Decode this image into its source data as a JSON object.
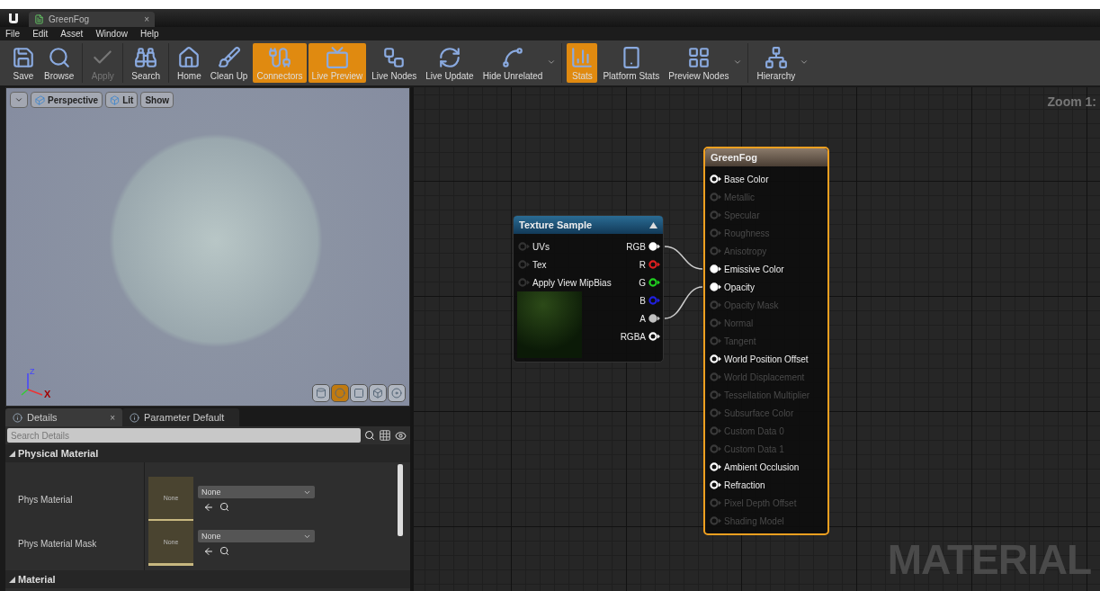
{
  "title_bar": {
    "tab": {
      "label": "GreenFog",
      "close": "×"
    }
  },
  "menu": [
    "File",
    "Edit",
    "Asset",
    "Window",
    "Help"
  ],
  "toolbar": [
    {
      "buttons": [
        {
          "label": "Save",
          "active": false,
          "disabled": false,
          "dropdown": false
        },
        {
          "label": "Browse",
          "active": false,
          "disabled": false,
          "dropdown": false
        }
      ]
    },
    {
      "buttons": [
        {
          "label": "Apply",
          "active": false,
          "disabled": true,
          "dropdown": false
        }
      ]
    },
    {
      "buttons": [
        {
          "label": "Search",
          "active": false,
          "disabled": false,
          "dropdown": false
        }
      ]
    },
    {
      "buttons": [
        {
          "label": "Home",
          "active": false,
          "disabled": false,
          "dropdown": false
        },
        {
          "label": "Clean Up",
          "active": false,
          "disabled": false,
          "dropdown": false
        },
        {
          "label": "Connectors",
          "active": true,
          "disabled": false,
          "dropdown": false
        },
        {
          "label": "Live Preview",
          "active": true,
          "disabled": false,
          "dropdown": false
        },
        {
          "label": "Live Nodes",
          "active": false,
          "disabled": false,
          "dropdown": false
        },
        {
          "label": "Live Update",
          "active": false,
          "disabled": false,
          "dropdown": false
        },
        {
          "label": "Hide Unrelated",
          "active": false,
          "disabled": false,
          "dropdown": true
        }
      ]
    },
    {
      "buttons": [
        {
          "label": "Stats",
          "active": true,
          "disabled": false,
          "dropdown": false
        },
        {
          "label": "Platform Stats",
          "active": false,
          "disabled": false,
          "dropdown": false
        },
        {
          "label": "Preview Nodes",
          "active": false,
          "disabled": false,
          "dropdown": true
        }
      ]
    },
    {
      "buttons": [
        {
          "label": "Hierarchy",
          "active": false,
          "disabled": false,
          "dropdown": true
        }
      ]
    }
  ],
  "viewport": {
    "buttons": [
      {
        "kind": "menu"
      },
      {
        "kind": "label",
        "label": "Perspective"
      },
      {
        "kind": "label",
        "label": "Lit"
      },
      {
        "kind": "label",
        "label": "Show"
      }
    ],
    "preview_shapes": [
      {
        "selected": false
      },
      {
        "selected": true
      },
      {
        "selected": false
      },
      {
        "selected": false
      },
      {
        "selected": false
      }
    ],
    "axes": {
      "x": "X",
      "z": "Z"
    }
  },
  "details": {
    "tabs": [
      {
        "label": "Details",
        "selected": true,
        "close": "×"
      },
      {
        "label": "Parameter Default",
        "selected": false
      }
    ],
    "search": {
      "placeholder": "Search Details"
    },
    "categories": [
      {
        "label": "Physical Material",
        "expanded": true,
        "rows": [
          {
            "label": "Phys Material",
            "thumbnail": "None",
            "value": "None"
          },
          {
            "label": "Phys Material Mask",
            "thumbnail": "None",
            "value": "None"
          }
        ]
      },
      {
        "label": "Material",
        "expanded": true
      }
    ]
  },
  "graph": {
    "zoom": "Zoom 1:",
    "watermark": "MATERIAL",
    "texture_node": {
      "title": "Texture Sample",
      "inputs": [
        "UVs",
        "Tex",
        "Apply View MipBias"
      ],
      "outputs": [
        {
          "label": "RGB",
          "color": "#ffffff",
          "connected": true
        },
        {
          "label": "R",
          "color": "#e02020",
          "connected": false
        },
        {
          "label": "G",
          "color": "#20d020",
          "connected": false
        },
        {
          "label": "B",
          "color": "#2020e0",
          "connected": false
        },
        {
          "label": "A",
          "color": "#c0c0c0",
          "connected": true
        },
        {
          "label": "RGBA",
          "color": "#ffffff",
          "connected": false
        }
      ]
    },
    "material_node": {
      "title": "GreenFog",
      "selected": true,
      "pins": [
        {
          "label": "Base Color",
          "enabled": true,
          "connected": false
        },
        {
          "label": "Metallic",
          "enabled": false,
          "connected": false
        },
        {
          "label": "Specular",
          "enabled": false,
          "connected": false
        },
        {
          "label": "Roughness",
          "enabled": false,
          "connected": false
        },
        {
          "label": "Anisotropy",
          "enabled": false,
          "connected": false
        },
        {
          "label": "Emissive Color",
          "enabled": true,
          "connected": true
        },
        {
          "label": "Opacity",
          "enabled": true,
          "connected": true
        },
        {
          "label": "Opacity Mask",
          "enabled": false,
          "connected": false
        },
        {
          "label": "Normal",
          "enabled": false,
          "connected": false
        },
        {
          "label": "Tangent",
          "enabled": false,
          "connected": false
        },
        {
          "label": "World Position Offset",
          "enabled": true,
          "connected": false
        },
        {
          "label": "World Displacement",
          "enabled": false,
          "connected": false
        },
        {
          "label": "Tessellation Multiplier",
          "enabled": false,
          "connected": false
        },
        {
          "label": "Subsurface Color",
          "enabled": false,
          "connected": false
        },
        {
          "label": "Custom Data 0",
          "enabled": false,
          "connected": false
        },
        {
          "label": "Custom Data 1",
          "enabled": false,
          "connected": false
        },
        {
          "label": "Ambient Occlusion",
          "enabled": true,
          "connected": false
        },
        {
          "label": "Refraction",
          "enabled": true,
          "connected": false
        },
        {
          "label": "Pixel Depth Offset",
          "enabled": false,
          "connected": false
        },
        {
          "label": "Shading Model",
          "enabled": false,
          "connected": false
        }
      ]
    }
  }
}
